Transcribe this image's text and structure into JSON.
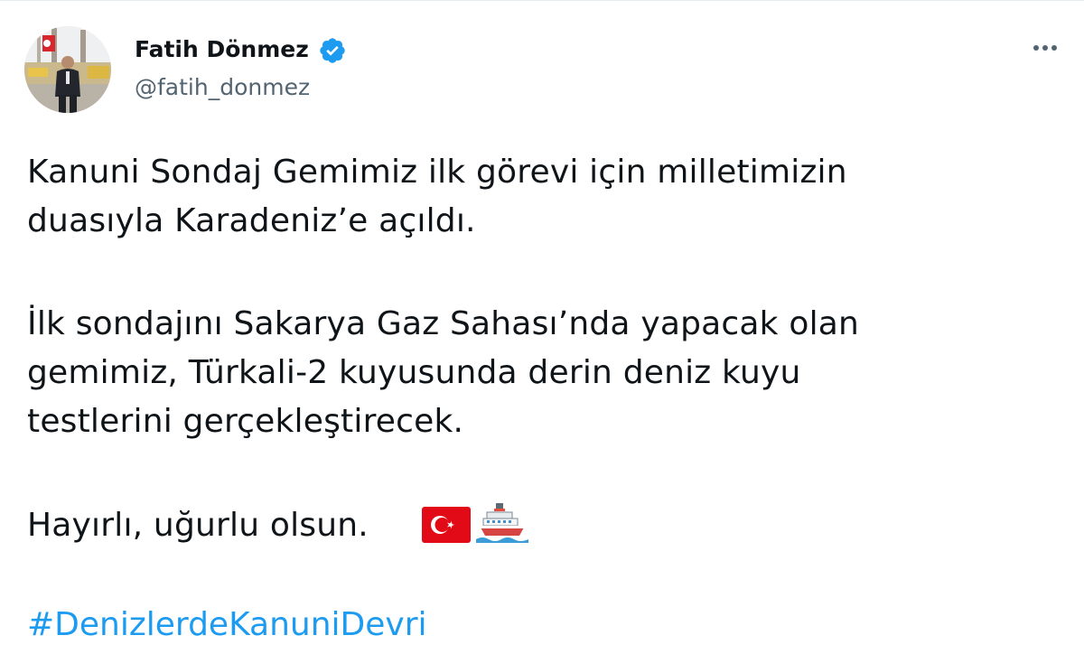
{
  "tweet": {
    "author": {
      "display_name": "Fatih Dönmez",
      "handle": "@fatih_donmez",
      "verified": true
    },
    "body": {
      "paragraph1": [
        "Kanuni Sondaj Gemimiz ilk görevi için milletimizin",
        "duasıyla Karadeniz’e açıldı."
      ],
      "paragraph2": [
        "İlk sondajını Sakarya Gaz Sahası’nda yapacak olan",
        "gemimiz, Türkali-2 kuyusunda derin deniz kuyu",
        "testlerini gerçekleştirecek."
      ],
      "paragraph3": "Hayırlı, uğurlu olsun.",
      "emojis": [
        "turkey-flag-icon",
        "ship-icon"
      ],
      "hashtag": "#DenizlerdeKanuniDevri"
    },
    "icons": {
      "verified": "verified-badge-icon",
      "more": "more-options-icon"
    },
    "colors": {
      "text": "#0f1419",
      "secondary": "#536471",
      "accent": "#1d9bf0",
      "flag_red": "#e30a17"
    }
  }
}
